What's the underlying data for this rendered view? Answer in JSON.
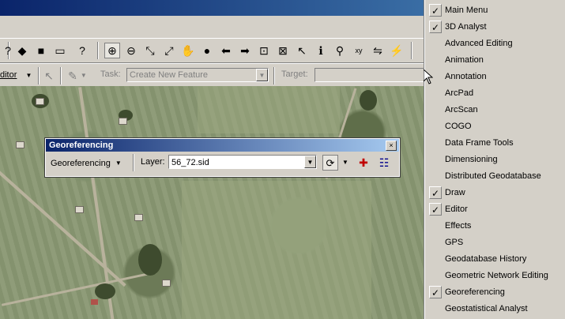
{
  "toolbar_tools": [
    {
      "icon": "help-arrow-icon",
      "glyph": "?"
    },
    {
      "icon": "add-data-icon",
      "glyph": "◆"
    },
    {
      "icon": "arctoolbox-icon",
      "glyph": "■"
    },
    {
      "icon": "window-icon",
      "glyph": "▭"
    },
    {
      "icon": "whats-this-icon",
      "glyph": "?"
    },
    {
      "icon": "zoom-in-icon",
      "glyph": "⊕"
    },
    {
      "icon": "zoom-out-icon",
      "glyph": "⊖"
    },
    {
      "icon": "fixed-zoom-in-icon",
      "glyph": "⤡"
    },
    {
      "icon": "fixed-zoom-out-icon",
      "glyph": "⤢"
    },
    {
      "icon": "pan-icon",
      "glyph": "✋"
    },
    {
      "icon": "full-extent-icon",
      "glyph": "●"
    },
    {
      "icon": "back-icon",
      "glyph": "⬅"
    },
    {
      "icon": "forward-icon",
      "glyph": "➡"
    },
    {
      "icon": "select-features-icon",
      "glyph": "⊡"
    },
    {
      "icon": "clear-selection-icon",
      "glyph": "⊠"
    },
    {
      "icon": "select-elements-icon",
      "glyph": "↖"
    },
    {
      "icon": "identify-icon",
      "glyph": "ℹ"
    },
    {
      "icon": "find-icon",
      "glyph": "⚲"
    },
    {
      "icon": "go-to-xy-icon",
      "glyph": "xy"
    },
    {
      "icon": "measure-icon",
      "glyph": "⇋"
    },
    {
      "icon": "hyperlink-icon",
      "glyph": "⚡"
    }
  ],
  "editor": {
    "label": "ditor",
    "task_label": "Task:",
    "task_value": "Create New Feature",
    "target_label": "Target:"
  },
  "georeferencing": {
    "title": "Georeferencing",
    "menu_label": "Georeferencing",
    "layer_label": "Layer:",
    "layer_value": "56_72.sid",
    "close_glyph": "×"
  },
  "menu": {
    "items": [
      {
        "label": "Main Menu",
        "checked": true
      },
      {
        "label": "3D Analyst",
        "checked": true
      },
      {
        "label": "Advanced Editing",
        "checked": false
      },
      {
        "label": "Animation",
        "checked": false
      },
      {
        "label": "Annotation",
        "checked": false
      },
      {
        "label": "ArcPad",
        "checked": false
      },
      {
        "label": "ArcScan",
        "checked": false
      },
      {
        "label": "COGO",
        "checked": false
      },
      {
        "label": "Data Frame Tools",
        "checked": false
      },
      {
        "label": "Dimensioning",
        "checked": false
      },
      {
        "label": "Distributed Geodatabase",
        "checked": false
      },
      {
        "label": "Draw",
        "checked": true
      },
      {
        "label": "Editor",
        "checked": true
      },
      {
        "label": "Effects",
        "checked": false
      },
      {
        "label": "GPS",
        "checked": false
      },
      {
        "label": "Geodatabase History",
        "checked": false
      },
      {
        "label": "Geometric Network Editing",
        "checked": false
      },
      {
        "label": "Georeferencing",
        "checked": true
      },
      {
        "label": "Geostatistical Analyst",
        "checked": false
      }
    ]
  },
  "colors": {
    "titlebar": "#0a246a",
    "menu_bg": "#d4d0c8"
  }
}
